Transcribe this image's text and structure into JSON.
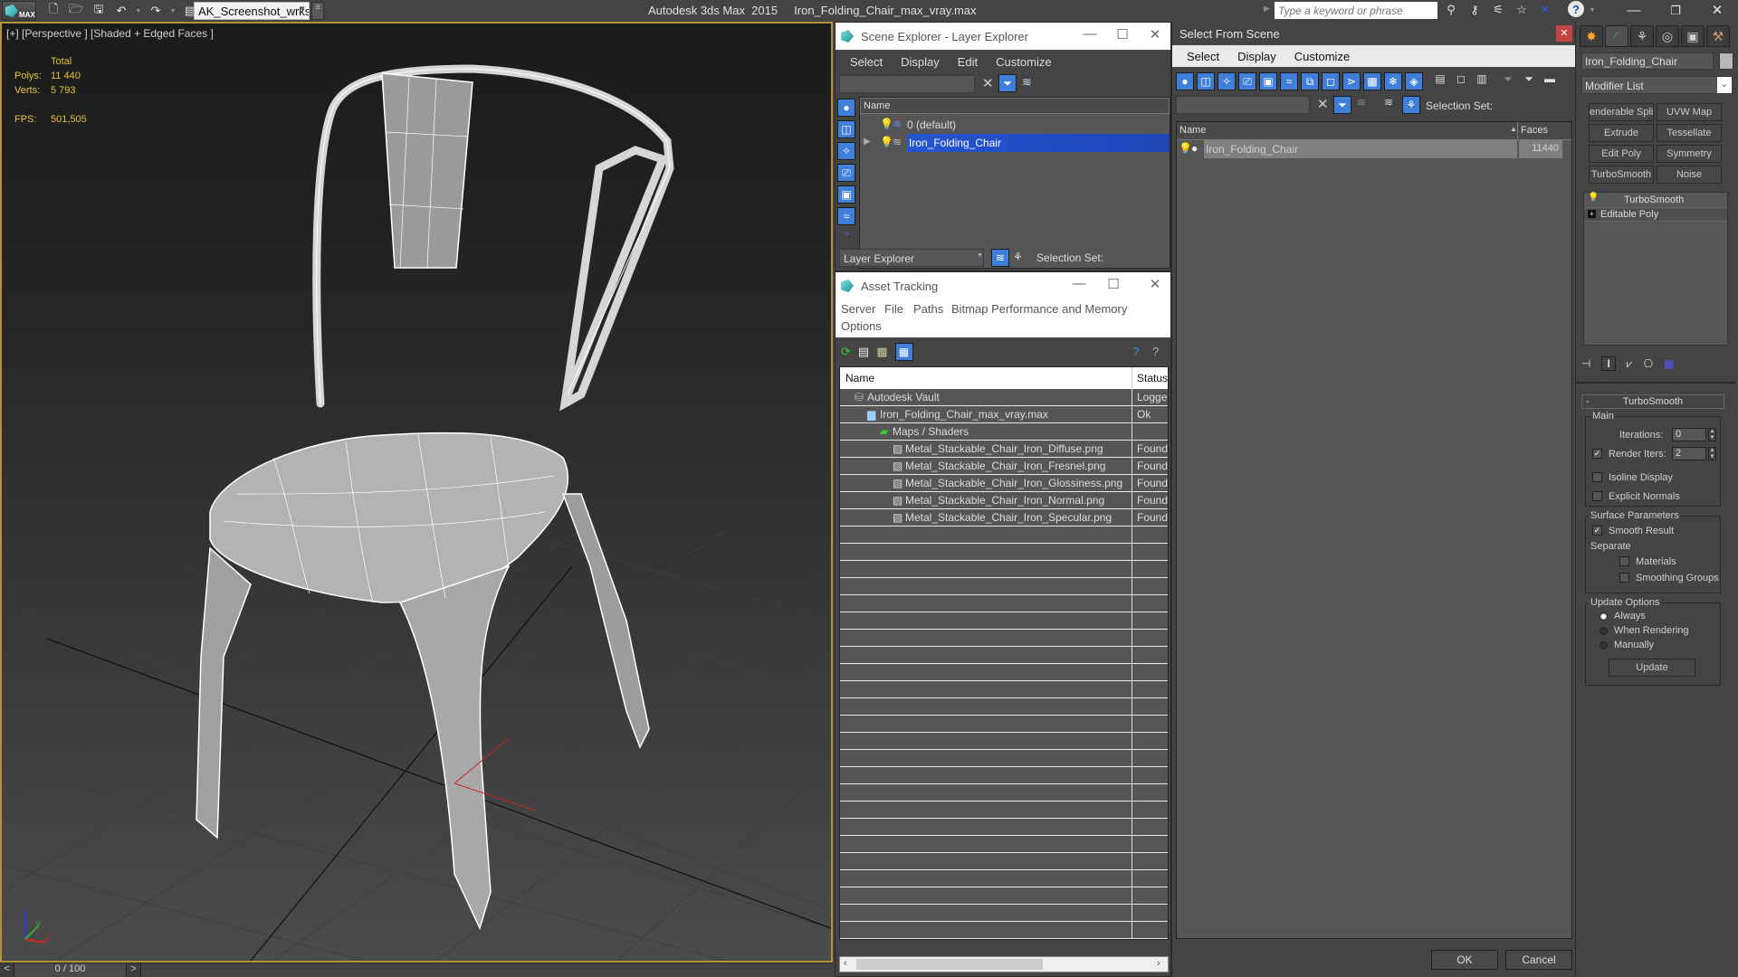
{
  "app": {
    "logo_label": "MAX",
    "workspace": "AK_Screenshot_wrksp",
    "product": "Autodesk 3ds Max  2015",
    "file_name": "Iron_Folding_Chair_max_vray.max",
    "search_placeholder": "Type a keyword or phrase",
    "toolbar_icons": [
      "new-file-icon",
      "open-file-icon",
      "save-icon",
      "undo-icon",
      "redo-icon",
      "project-folder-icon"
    ],
    "info_icons": [
      "binoculars-icon",
      "key-icon",
      "satellite-dish-icon",
      "star-icon",
      "x-icon",
      "help-icon"
    ]
  },
  "viewport": {
    "label": "[+] [Perspective ] [Shaded + Edged Faces ]",
    "stats": {
      "total_label": "Total",
      "polys_label": "Polys:",
      "polys": "11 440",
      "verts_label": "Verts:",
      "verts": "5 793",
      "fps_label": "FPS:",
      "fps": "501,505"
    },
    "axis_labels": {
      "x": "x",
      "y": "y",
      "z": "z"
    }
  },
  "timeline": {
    "prev": "<",
    "position": "0 / 100",
    "next": ">"
  },
  "scene_explorer": {
    "title": "Scene Explorer - Layer Explorer",
    "menu": [
      "Select",
      "Display",
      "Edit",
      "Customize"
    ],
    "column_name": "Name",
    "rows": [
      {
        "name": "0 (default)",
        "selected": false
      },
      {
        "name": "Iron_Folding_Chair",
        "selected": true
      }
    ],
    "explorer_type": "Layer Explorer",
    "selection_set_label": "Selection Set:"
  },
  "asset_tracking": {
    "title": "Asset Tracking",
    "menu": [
      "Server",
      "File",
      "Paths",
      "Bitmap Performance and Memory",
      "Options"
    ],
    "columns": [
      "Name",
      "Status"
    ],
    "rows": [
      {
        "name": "Autodesk Vault",
        "status": "Logge",
        "indent": 0,
        "icon": "vault-icon"
      },
      {
        "name": "Iron_Folding_Chair_max_vray.max",
        "status": "Ok",
        "indent": 1,
        "icon": "max-file-icon"
      },
      {
        "name": "Maps / Shaders",
        "status": "",
        "indent": 2,
        "icon": "maps-icon"
      },
      {
        "name": "Metal_Stackable_Chair_Iron_Diffuse.png",
        "status": "Found",
        "indent": 3,
        "icon": "image-file-icon"
      },
      {
        "name": "Metal_Stackable_Chair_Iron_Fresnel.png",
        "status": "Found",
        "indent": 3,
        "icon": "image-file-icon"
      },
      {
        "name": "Metal_Stackable_Chair_Iron_Glossiness.png",
        "status": "Found",
        "indent": 3,
        "icon": "image-file-icon"
      },
      {
        "name": "Metal_Stackable_Chair_Iron_Normal.png",
        "status": "Found",
        "indent": 3,
        "icon": "image-file-icon"
      },
      {
        "name": "Metal_Stackable_Chair_Iron_Specular.png",
        "status": "Found",
        "indent": 3,
        "icon": "image-file-icon"
      }
    ]
  },
  "select_from_scene": {
    "title": "Select From Scene",
    "menu": [
      "Select",
      "Display",
      "Customize"
    ],
    "selection_set_label": "Selection Set:",
    "columns": [
      "Name",
      "Faces"
    ],
    "rows": [
      {
        "name": "Iron_Folding_Chair",
        "faces": "11440"
      }
    ],
    "ok_label": "OK",
    "cancel_label": "Cancel"
  },
  "command_panel": {
    "object_name": "Iron_Folding_Chair",
    "modifier_list": "Modifier List",
    "modifier_buttons": [
      "enderable Splin",
      "UVW Map",
      "Extrude",
      "Tessellate",
      "Edit Poly",
      "Symmetry",
      "TurboSmooth",
      "Noise"
    ],
    "stack": [
      "TurboSmooth",
      "Editable Poly"
    ],
    "rollout_title": "TurboSmooth",
    "main_group": "Main",
    "iterations_label": "Iterations:",
    "iterations": "0",
    "render_iters_label": "Render Iters:",
    "render_iters": "2",
    "render_iters_checked": true,
    "isoline_label": "Isoline Display",
    "explicit_normals_label": "Explicit Normals",
    "surface_group": "Surface Parameters",
    "smooth_result_label": "Smooth Result",
    "separate_label": "Separate",
    "materials_label": "Materials",
    "smoothing_groups_label": "Smoothing Groups",
    "update_group": "Update Options",
    "update_always": "Always",
    "update_when_rendering": "When Rendering",
    "update_manually": "Manually",
    "update_button": "Update"
  }
}
